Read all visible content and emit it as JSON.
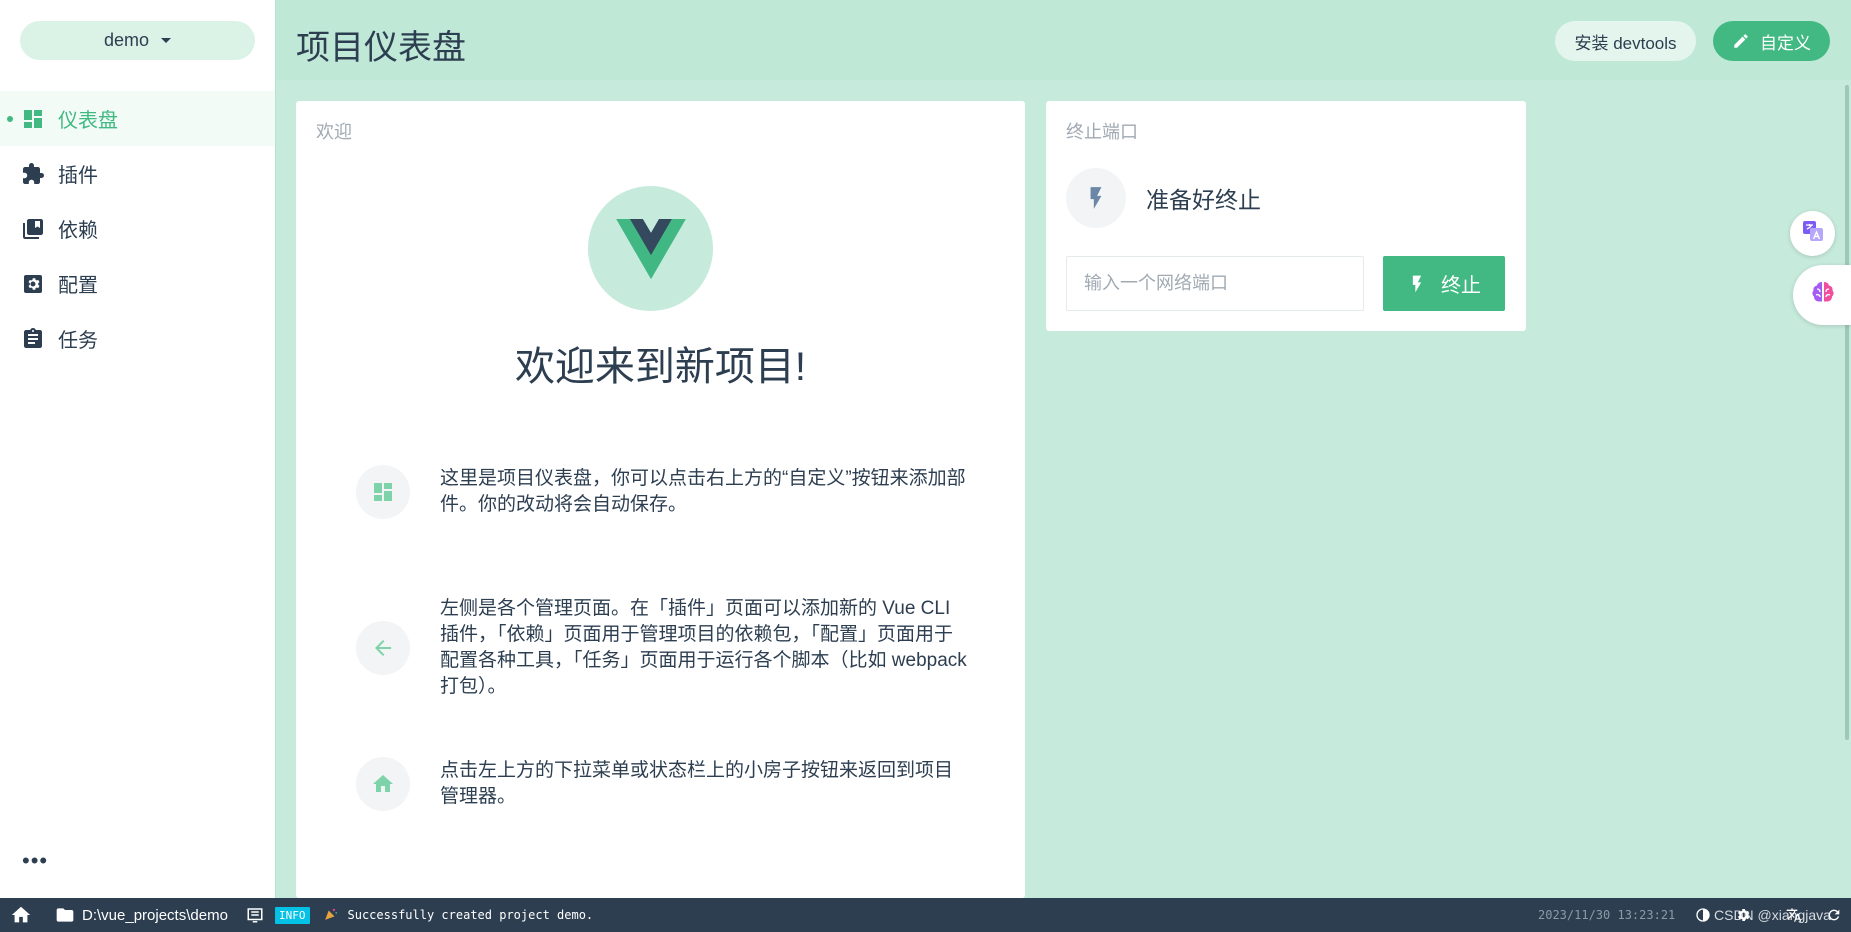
{
  "sidebar": {
    "project_name": "demo",
    "items": [
      {
        "label": "仪表盘",
        "icon": "dashboard-icon",
        "active": true
      },
      {
        "label": "插件",
        "icon": "puzzle-icon",
        "active": false
      },
      {
        "label": "依赖",
        "icon": "library-books-icon",
        "active": false
      },
      {
        "label": "配置",
        "icon": "settings-box-icon",
        "active": false
      },
      {
        "label": "任务",
        "icon": "clipboard-icon",
        "active": false
      }
    ],
    "more_label": "•••"
  },
  "header": {
    "title": "项目仪表盘",
    "devtools_label": "安装 devtools",
    "customize_label": "自定义"
  },
  "welcome": {
    "card_title": "欢迎",
    "heading": "欢迎来到新项目!",
    "tips": [
      {
        "icon": "dashboard-icon",
        "text": "这里是项目仪表盘，你可以点击右上方的“自定义”按钮来添加部件。你的改动将会自动保存。"
      },
      {
        "icon": "arrow-left-icon",
        "text": "左侧是各个管理页面。在「插件」页面可以添加新的 Vue CLI 插件，「依赖」页面用于管理项目的依赖包，「配置」页面用于配置各种工具，「任务」页面用于运行各个脚本（比如 webpack 打包）。"
      },
      {
        "icon": "home-icon",
        "text": "点击左上方的下拉菜单或状态栏上的小房子按钮来返回到项目管理器。"
      }
    ]
  },
  "kill_port": {
    "card_title": "终止端口",
    "status": "准备好终止",
    "input_placeholder": "输入一个网络端口",
    "input_value": "",
    "button_label": "终止"
  },
  "statusbar": {
    "path": "D:\\vue_projects\\demo",
    "log_level": "INFO",
    "log_message": "Successfully created project demo.",
    "timestamp": "2023/11/30 13:23:21",
    "watermark": "CSDN @xiangjava"
  },
  "colors": {
    "accent": "#42b983",
    "dark": "#2c3e50",
    "main_bg": "#c6eadc",
    "info_badge": "#03c2e6"
  }
}
